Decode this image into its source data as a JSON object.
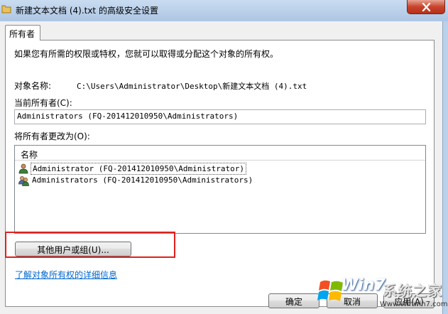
{
  "window": {
    "title": "新建文本文档 (4).txt 的高级安全设置",
    "close_glyph": "✕"
  },
  "tabs": [
    {
      "label": "所有者"
    }
  ],
  "owner_tab": {
    "description": "如果您有所需的权限或特权，您就可以取得或分配这个对象的所有权。",
    "object_name_label": "对象名称:",
    "object_name_value": "C:\\Users\\Administrator\\Desktop\\新建文本文档 (4).txt",
    "current_owner_label": "当前所有者(C):",
    "current_owner_value": "Administrators (FQ-201412010950\\Administrators)",
    "change_owner_label": "将所有者更改为(O):",
    "list_header": "名称",
    "owners": [
      {
        "name": "Administrator (FQ-201412010950\\Administrator)",
        "icon": "user-icon",
        "selected": true
      },
      {
        "name": "Administrators (FQ-201412010950\\Administrators)",
        "icon": "group-icon",
        "selected": false
      }
    ],
    "other_users_button": "其他用户或组(U)...",
    "learn_more_link": "了解对象所有权的详细信息"
  },
  "buttons": {
    "ok": "确定",
    "cancel": "取消",
    "apply": "应用(A)"
  },
  "watermark": {
    "logo_text": "Win7",
    "site_text": "系统之家",
    "url": "Www.Winwin7.com"
  },
  "colors": {
    "link": "#0066cc",
    "highlight_box": "#e0201c",
    "close_button": "#c7442c"
  }
}
